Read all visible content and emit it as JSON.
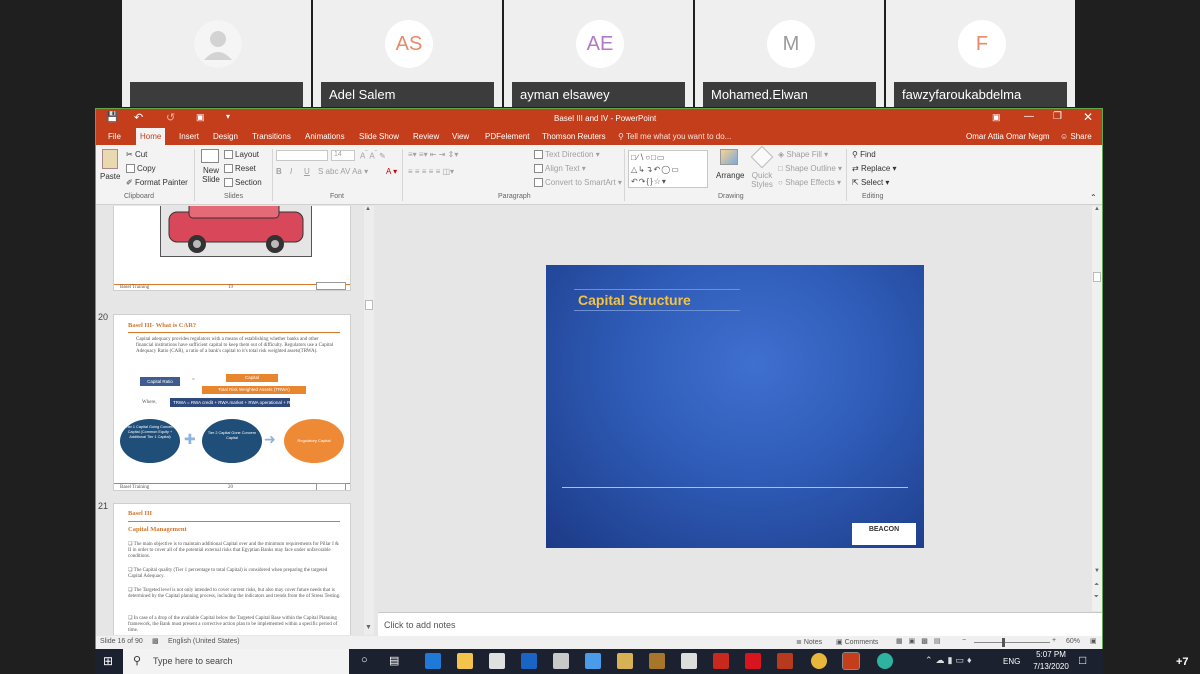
{
  "participants": [
    {
      "initials": "",
      "name": ""
    },
    {
      "initials": "AS",
      "name": "Adel Salem"
    },
    {
      "initials": "AE",
      "name": "ayman elsawey"
    },
    {
      "initials": "M",
      "name": "Mohamed.Elwan"
    },
    {
      "initials": "F",
      "name": "fawzyfaroukabdelma"
    }
  ],
  "window": {
    "title": "Basel III and IV - PowerPoint",
    "user": "Omar Attia Omar Negm",
    "share": "Share"
  },
  "tabs": [
    "File",
    "Home",
    "Insert",
    "Design",
    "Transitions",
    "Animations",
    "Slide Show",
    "Review",
    "View",
    "PDFelement",
    "Thomson Reuters"
  ],
  "tellme": "Tell me what you want to do...",
  "ribbon": {
    "clipboard": {
      "paste": "Paste",
      "cut": "Cut",
      "copy": "Copy",
      "format_painter": "Format Painter",
      "label": "Clipboard"
    },
    "slides": {
      "new_slide": "New Slide",
      "layout": "Layout",
      "reset": "Reset",
      "section": "Section",
      "label": "Slides"
    },
    "font": {
      "size": "14",
      "label": "Font"
    },
    "paragraph": {
      "text_direction": "Text Direction",
      "align_text": "Align Text",
      "convert": "Convert to SmartArt",
      "label": "Paragraph"
    },
    "drawing": {
      "arrange": "Arrange",
      "quick_styles": "Quick Styles",
      "shape_fill": "Shape Fill",
      "shape_outline": "Shape Outline",
      "shape_effects": "Shape Effects",
      "label": "Drawing"
    },
    "editing": {
      "find": "Find",
      "replace": "Replace",
      "select": "Select",
      "label": "Editing"
    }
  },
  "thumbnails": [
    {
      "number": "20",
      "title": "Basel III- What is CAR?",
      "body": "Capital adequacy provides regulators with a means of establishing whether banks and other financial institutions have sufficient capital to keep them out of difficulty. Regulators use a Capital Adequacy Ratio (CAR), a ratio of a bank's capital to it's total risk weighted assets(TRWA).",
      "formula_left": "Capital Ratio",
      "formula_top": "Capital",
      "formula_bottom": "Total Risk Weighted Assets (TRWA)",
      "where": "Where,",
      "where_formula": "TRWA = RWA credit + RWA market + RWA operational + RWA other",
      "circle1": "Tier 1 Capital Going Concern Capital (Common Equity + Additional Tier 1 Capital)",
      "circle2": "Tier 2 Capital Gone Concern Capital",
      "circle3": "Regulatory Capital",
      "footer": "Basel Training",
      "page": "20"
    },
    {
      "number": "21",
      "title": "Basel III",
      "subtitle": "Capital Management",
      "bullets": [
        "The main objective is to maintain additional Capital over and the minimum requirements for Pillar I & II in order to cover all of the potential external risks that Egyptian Banks may face under unfavorable conditions.",
        "The Capital quality (Tier 1 percentage to total Capital) is considered when preparing the targeted Capital Adequacy.",
        "The Targeted level is not only intended to cover current risks, but also may cover future needs that is determined by the Capital planning process, including the indicators and trends from the of Stress Testing.",
        "In case of a drop of the available Capital below the Targeted Capital Base within the Capital Planning framework, the Bank must present a corrective action plan to be implemented within a specific period of time."
      ]
    },
    {
      "footer": "Basel Training",
      "page": "19"
    }
  ],
  "slide": {
    "title": "Capital Structure",
    "logo": "BEACON"
  },
  "notes_placeholder": "Click to add notes",
  "status": {
    "slide_info": "Slide 16 of 90",
    "language": "English (United States)",
    "notes": "Notes",
    "comments": "Comments",
    "zoom": "60%"
  },
  "taskbar": {
    "search_placeholder": "Type here to search",
    "lang": "ENG",
    "time": "5:07 PM",
    "date": "7/13/2020",
    "more_participants": "+7"
  },
  "colors": {
    "ppt_accent": "#c43e1c",
    "slide_title": "#f5c242",
    "taskbar": "#1c2130"
  }
}
